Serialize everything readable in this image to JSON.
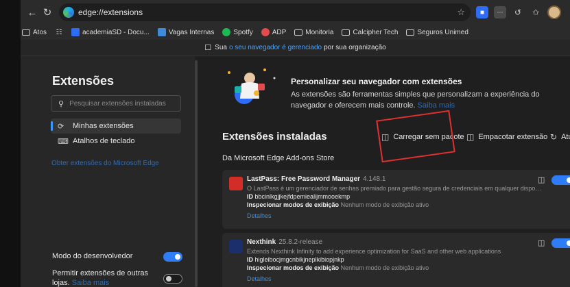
{
  "address_bar": {
    "url": "edge://extensions"
  },
  "favorites": [
    {
      "label": "Atos",
      "icon": "folder-icon"
    },
    {
      "label": "",
      "icon": "ms-icon"
    },
    {
      "label": "academiaSD - Docu...",
      "icon": "doc-icon"
    },
    {
      "label": "Vagas Internas",
      "icon": "sharepoint-icon"
    },
    {
      "label": "Spotfy",
      "icon": "spotify-icon"
    },
    {
      "label": "ADP",
      "icon": "adp-icon"
    },
    {
      "label": "Monitoria",
      "icon": "folder-icon"
    },
    {
      "label": "Calcipher Tech",
      "icon": "folder-icon"
    },
    {
      "label": "Seguros Unimed",
      "icon": "folder-icon"
    }
  ],
  "banner": {
    "prefix": "Sua",
    "link": "o seu navegador é gerenciado",
    "suffix": "por sua organização"
  },
  "sidebar": {
    "title": "Extensões",
    "search_placeholder": "Pesquisar extensões instaladas",
    "items": [
      {
        "label": "Minhas extensões",
        "active": true
      },
      {
        "label": "Atalhos de teclado",
        "active": false
      }
    ],
    "get_extensions_link": "Obter extensões do Microsoft Edge",
    "dev_mode_label": "Modo do desenvolvedor",
    "allow_other_stores_label": "Permitir extensões de outras lojas.",
    "allow_other_stores_link": "Saiba mais"
  },
  "hero": {
    "title": "Personalizar seu navegador com extensões",
    "text": "As extensões são ferramentas simples que personalizam a experiência do navegador e oferecem mais controle.",
    "link": "Saiba mais"
  },
  "installed": {
    "title": "Extensões instaladas",
    "load_unpacked": "Carregar sem pacote",
    "pack_extension": "Empacotar extensão",
    "update": "Atualizar",
    "store_label": "Da Microsoft Edge Add-ons Store"
  },
  "extensions": [
    {
      "name": "LastPass: Free Password Manager",
      "version": "4.148.1",
      "description": "O LastPass é um gerenciador de senhas premiado para gestão segura de credenciais em qualquer dispositi...",
      "id_label": "ID",
      "id": "bbcinlkgjjkejfdpemiealijmmooekmp",
      "inspect_label": "Inspecionar modos de exibição",
      "inspect_value": "Nenhum modo de exibição ativo",
      "details": "Detalhes",
      "icon_color": "#d32d27"
    },
    {
      "name": "Nexthink",
      "version": "25.8.2-release",
      "description": "Extends Nexthink Infinity to add experience optimization for SaaS and other web applications",
      "id_label": "ID",
      "id": "higleibocjmgcnbikjneplkibiopjnkp",
      "inspect_label": "Inspecionar modos de exibição",
      "inspect_value": "Nenhum modo de exibição ativo",
      "details": "Detalhes",
      "icon_color": "#1a2f6b"
    }
  ],
  "colors": {
    "accent": "#2f7df6",
    "link": "#3f8de0",
    "annotation": "#e03030"
  }
}
